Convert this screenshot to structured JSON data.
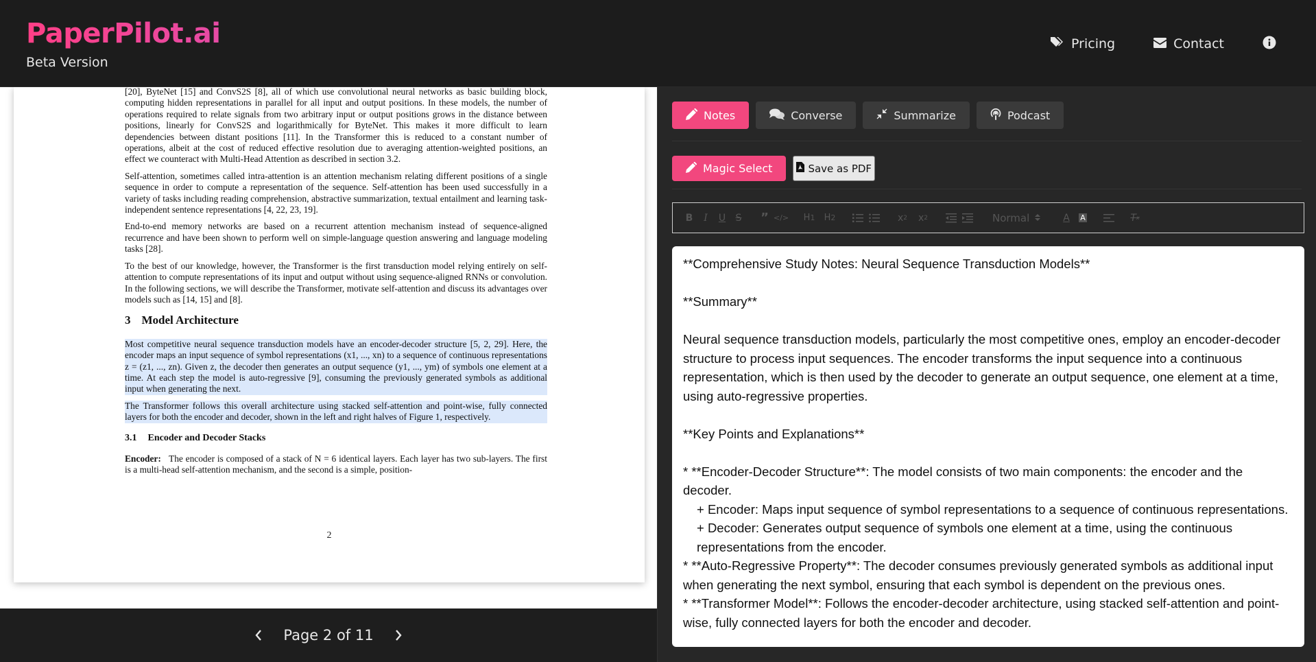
{
  "header": {
    "brand": "PaperPilot.ai",
    "subtitle": "Beta Version",
    "nav": [
      {
        "label": "Pricing",
        "icon": "tags-icon"
      },
      {
        "label": "Contact",
        "icon": "envelope-icon"
      }
    ],
    "info_icon": "info-circle-icon"
  },
  "colors": {
    "accent": "#f2477e",
    "brand_from": "#ff3f86",
    "brand_to": "#e54ba5",
    "highlight": "#dbe8fb"
  },
  "pdf": {
    "paragraphs": [
      "[20], ByteNet [15] and ConvS2S [8], all of which use convolutional neural networks as basic building block, computing hidden representations in parallel for all input and output positions. In these models, the number of operations required to relate signals from two arbitrary input or output positions grows in the distance between positions, linearly for ConvS2S and logarithmically for ByteNet. This makes it more difficult to learn dependencies between distant positions [11]. In the Transformer this is reduced to a constant number of operations, albeit at the cost of reduced effective resolution due to averaging attention-weighted positions, an effect we counteract with Multi-Head Attention as described in section 3.2.",
      "Self-attention, sometimes called intra-attention is an attention mechanism relating different positions of a single sequence in order to compute a representation of the sequence. Self-attention has been used successfully in a variety of tasks including reading comprehension, abstractive summarization, textual entailment and learning task-independent sentence representations [4, 22, 23, 19].",
      "End-to-end memory networks are based on a recurrent attention mechanism instead of sequence-aligned recurrence and have been shown to perform well on simple-language question answering and language modeling tasks [28].",
      "To the best of our knowledge, however, the Transformer is the first transduction model relying entirely on self-attention to compute representations of its input and output without using sequence-aligned RNNs or convolution. In the following sections, we will describe the Transformer, motivate self-attention and discuss its advantages over models such as [14, 15] and [8]."
    ],
    "section_number": "3",
    "section_title": "Model Architecture",
    "highlighted_paragraphs": [
      "Most competitive neural sequence transduction models have an encoder-decoder structure [5, 2, 29]. Here, the encoder maps an input sequence of symbol representations (x1, ..., xn) to a sequence of continuous representations z = (z1, ..., zn). Given z, the decoder then generates an output sequence (y1, ..., ym) of symbols one element at a time. At each step the model is auto-regressive [9], consuming the previously generated symbols as additional input when generating the next.",
      "The Transformer follows this overall architecture using stacked self-attention and point-wise, fully connected layers for both the encoder and decoder, shown in the left and right halves of Figure 1, respectively."
    ],
    "subsection_number": "3.1",
    "subsection_title": "Encoder and Decoder Stacks",
    "encoder_label": "Encoder:",
    "encoder_text": "The encoder is composed of a stack of N = 6 identical layers. Each layer has two sub-layers. The first is a multi-head self-attention mechanism, and the second is a simple, position-",
    "page_number": "2"
  },
  "pager": {
    "label": "Page 2 of 11",
    "prev_icon": "chevron-left-icon",
    "next_icon": "chevron-right-icon"
  },
  "tabs": [
    {
      "label": "Notes",
      "icon": "pencil-icon",
      "active": true
    },
    {
      "label": "Converse",
      "icon": "comments-icon",
      "active": false
    },
    {
      "label": "Summarize",
      "icon": "compress-icon",
      "active": false
    },
    {
      "label": "Podcast",
      "icon": "podcast-icon",
      "active": false
    }
  ],
  "actions": {
    "magic_select": "Magic Select",
    "save_pdf": "Save as PDF"
  },
  "toolbar": {
    "heading_select": "Normal"
  },
  "notes": {
    "lines": [
      "**Comprehensive Study Notes: Neural Sequence Transduction Models**",
      "",
      "**Summary**",
      "",
      "Neural sequence transduction models, particularly the most competitive ones, employ an encoder-decoder structure to process input sequences. The encoder transforms the input sequence into a continuous representation, which is then used by the decoder to generate an output sequence, one element at a time, using auto-regressive properties.",
      "",
      "**Key Points and Explanations**",
      "",
      "* **Encoder-Decoder Structure**: The model consists of two main components: the encoder and the decoder.",
      "+ Encoder: Maps input sequence of symbol representations to a sequence of continuous representations.",
      "+ Decoder: Generates output sequence of symbols one element at a time, using the continuous representations from the encoder.",
      "* **Auto-Regressive Property**: The decoder consumes previously generated symbols as additional input when generating the next symbol, ensuring that each symbol is dependent on the previous ones.",
      "* **Transformer Model**: Follows the encoder-decoder architecture, using stacked self-attention and point-wise, fully connected layers for both the encoder and decoder."
    ]
  }
}
